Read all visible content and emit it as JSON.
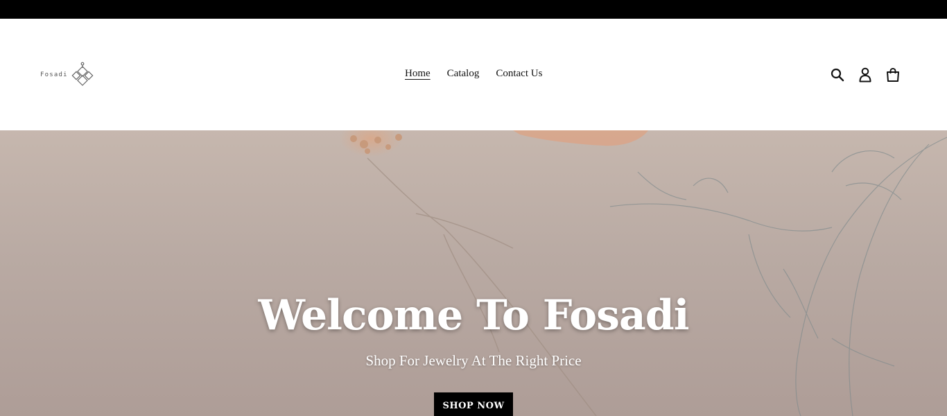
{
  "brand": {
    "logo_text": "Fosadi"
  },
  "nav": {
    "items": [
      {
        "label": "Home",
        "active": true
      },
      {
        "label": "Catalog",
        "active": false
      },
      {
        "label": "Contact Us",
        "active": false
      }
    ]
  },
  "header_icons": [
    "search-icon",
    "account-icon",
    "cart-icon"
  ],
  "hero": {
    "title": "Welcome To Fosadi",
    "subtitle": "Shop For Jewelry At The Right Price",
    "cta_label": "SHOP NOW"
  },
  "colors": {
    "announcement_bar": "#000000",
    "hero_overlay": "#b9aaa3",
    "button": "#000000"
  }
}
